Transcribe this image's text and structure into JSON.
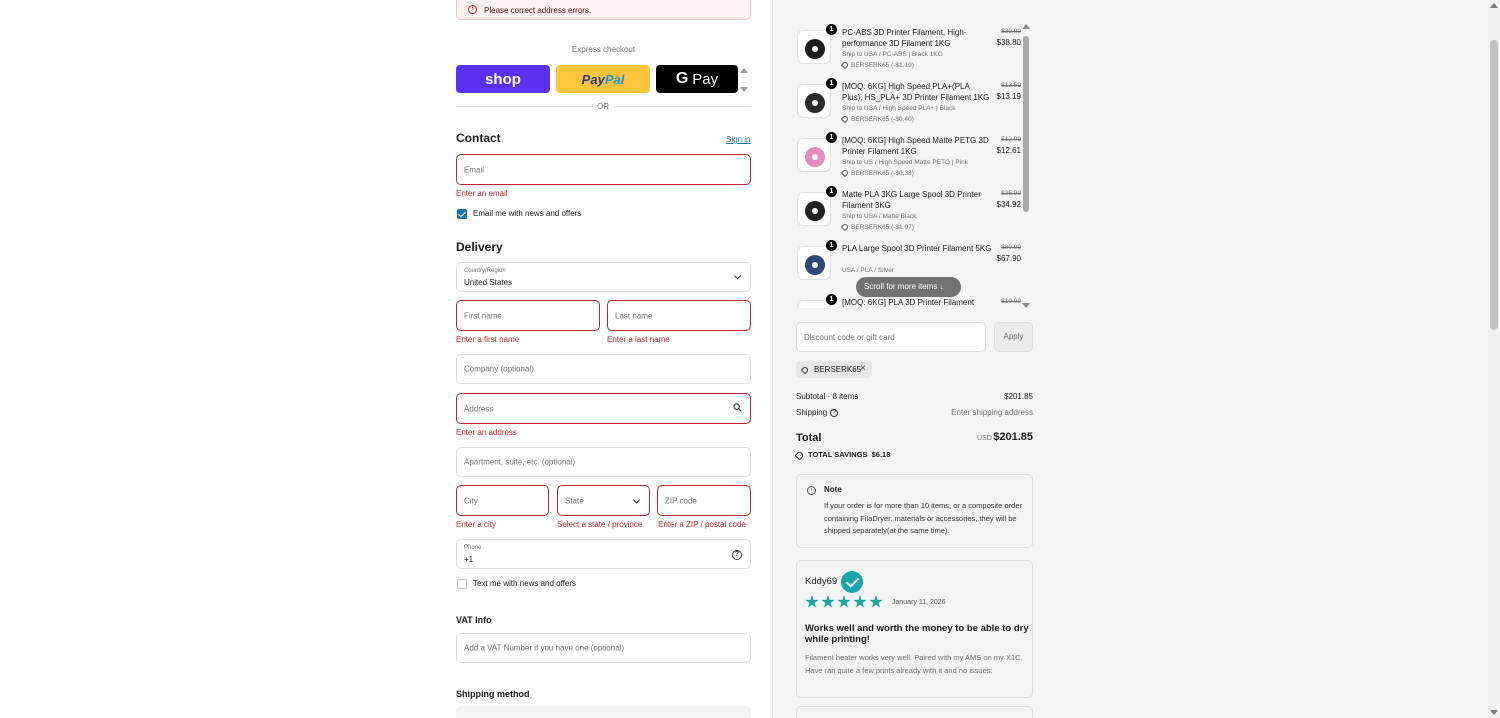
{
  "error_banner": {
    "text": "Please correct address errors."
  },
  "express": {
    "label": "Express checkout",
    "shop_label": "shop",
    "paypal_label_pay": "Pay",
    "paypal_label_pal": "Pal",
    "gpay_label_g": "G",
    "gpay_label_pay": "Pay",
    "or_text": "OR"
  },
  "contact": {
    "title": "Contact",
    "sign_in": "Sign in",
    "email_placeholder": "Email",
    "email_error": "Enter an email",
    "news_checkbox_label": "Email me with news and offers",
    "news_checked": true
  },
  "delivery": {
    "title": "Delivery",
    "country_label": "Country/Region",
    "country_value": "United States",
    "first_name_placeholder": "First name",
    "first_name_error": "Enter a first name",
    "last_name_placeholder": "Last name",
    "last_name_error": "Enter a last name",
    "company_placeholder": "Company (optional)",
    "address_placeholder": "Address",
    "address_error": "Enter an address",
    "apartment_placeholder": "Apartment, suite, etc. (optional)",
    "city_placeholder": "City",
    "city_error": "Enter a city",
    "state_placeholder": "State",
    "state_error": "Select a state / province",
    "zip_placeholder": "ZIP code",
    "zip_error": "Enter a ZIP / postal code",
    "phone_label": "Phone",
    "phone_value": "+1",
    "sms_checkbox_label": "Text me with news and offers",
    "sms_checked": false
  },
  "vat": {
    "title": "VAT Info",
    "placeholder": "Add a VAT Number if you have one (optional)"
  },
  "shipping_method": {
    "title": "Shipping method"
  },
  "cart": {
    "items": [
      {
        "qty": "1",
        "name": "PC-ABS 3D Printer Filament, High-performance 3D Filament 1KG",
        "variant": "Ship to USA / PC-ABS | Black 1KG",
        "discount": "BERSERK65 (-$1.19)",
        "old_price": "$39.99",
        "price": "$38.80",
        "color": "#1e1e1e"
      },
      {
        "qty": "1",
        "name": "[MOQ: 6KG] High Speed PLA+(PLA Plus), HS_PLA+ 3D Printer Filament 1KG",
        "variant": "Ship to USA / High Speed PLA+ | Black",
        "discount": "BERSERK65 (-$0.40)",
        "old_price": "$13.59",
        "price": "$13.19",
        "color": "#2a2a2a"
      },
      {
        "qty": "1",
        "name": "[MOQ: 6KG] High Speed Matte PETG 3D Printer Filament 1KG",
        "variant": "Ship to US / High Speed Matte PETG | Pink",
        "discount": "BERSERK65 (-$0.38)",
        "old_price": "$12.99",
        "price": "$12.61",
        "color": "#e58bbd"
      },
      {
        "qty": "1",
        "name": "Matte PLA 3KG Large Spool 3D Printer Filament 3KG",
        "variant": "Ship to USA / Matte Black",
        "discount": "BERSERK65 (-$1.07)",
        "old_price": "$35.99",
        "price": "$34.92",
        "color": "#222222"
      },
      {
        "qty": "1",
        "name": "PLA Large Spool 3D Printer Filament 5KG",
        "variant": "USA / PLA / Silver",
        "discount": "",
        "old_price": "$69.99",
        "price": "$67.90",
        "color": "#2b4a7a"
      },
      {
        "qty": "1",
        "name": "[MOQ: 6KG] PLA 3D Printer Filament",
        "variant": "",
        "discount": "",
        "old_price": "$10.99",
        "price": "",
        "color": "#2e8b57"
      }
    ],
    "scroll_hint": "Scroll for more items",
    "discount_placeholder": "Discount code or gift card",
    "apply_label": "Apply",
    "applied_code": "BERSERK65",
    "subtotal_label": "Subtotal · 8 items",
    "subtotal_value": "$201.85",
    "shipping_label": "Shipping",
    "shipping_value": "Enter shipping address",
    "total_label": "Total",
    "total_currency": "USD",
    "total_value": "$201.85",
    "savings_label": "TOTAL SAVINGS",
    "savings_value": "$6.18"
  },
  "note": {
    "title": "Note",
    "body": "If your order is for more than 10 items, or a composite order containing FilaDryer, materials or accessories, they will be shipped separately(at the same time)."
  },
  "review": {
    "author": "Kddy69",
    "stars": 5,
    "date": "January 11, 2026",
    "headline": "Works well and worth the money to be able to dry while printing!",
    "body": "Filament heater works very well. Paired with my AMS on my X1C. Have ran quite a few prints already with it and no issues."
  },
  "colors": {
    "error": "#c0262d",
    "link": "#1773b0",
    "shop": "#5a31f4",
    "paypal": "#ffc439",
    "star": "#19a39b"
  }
}
